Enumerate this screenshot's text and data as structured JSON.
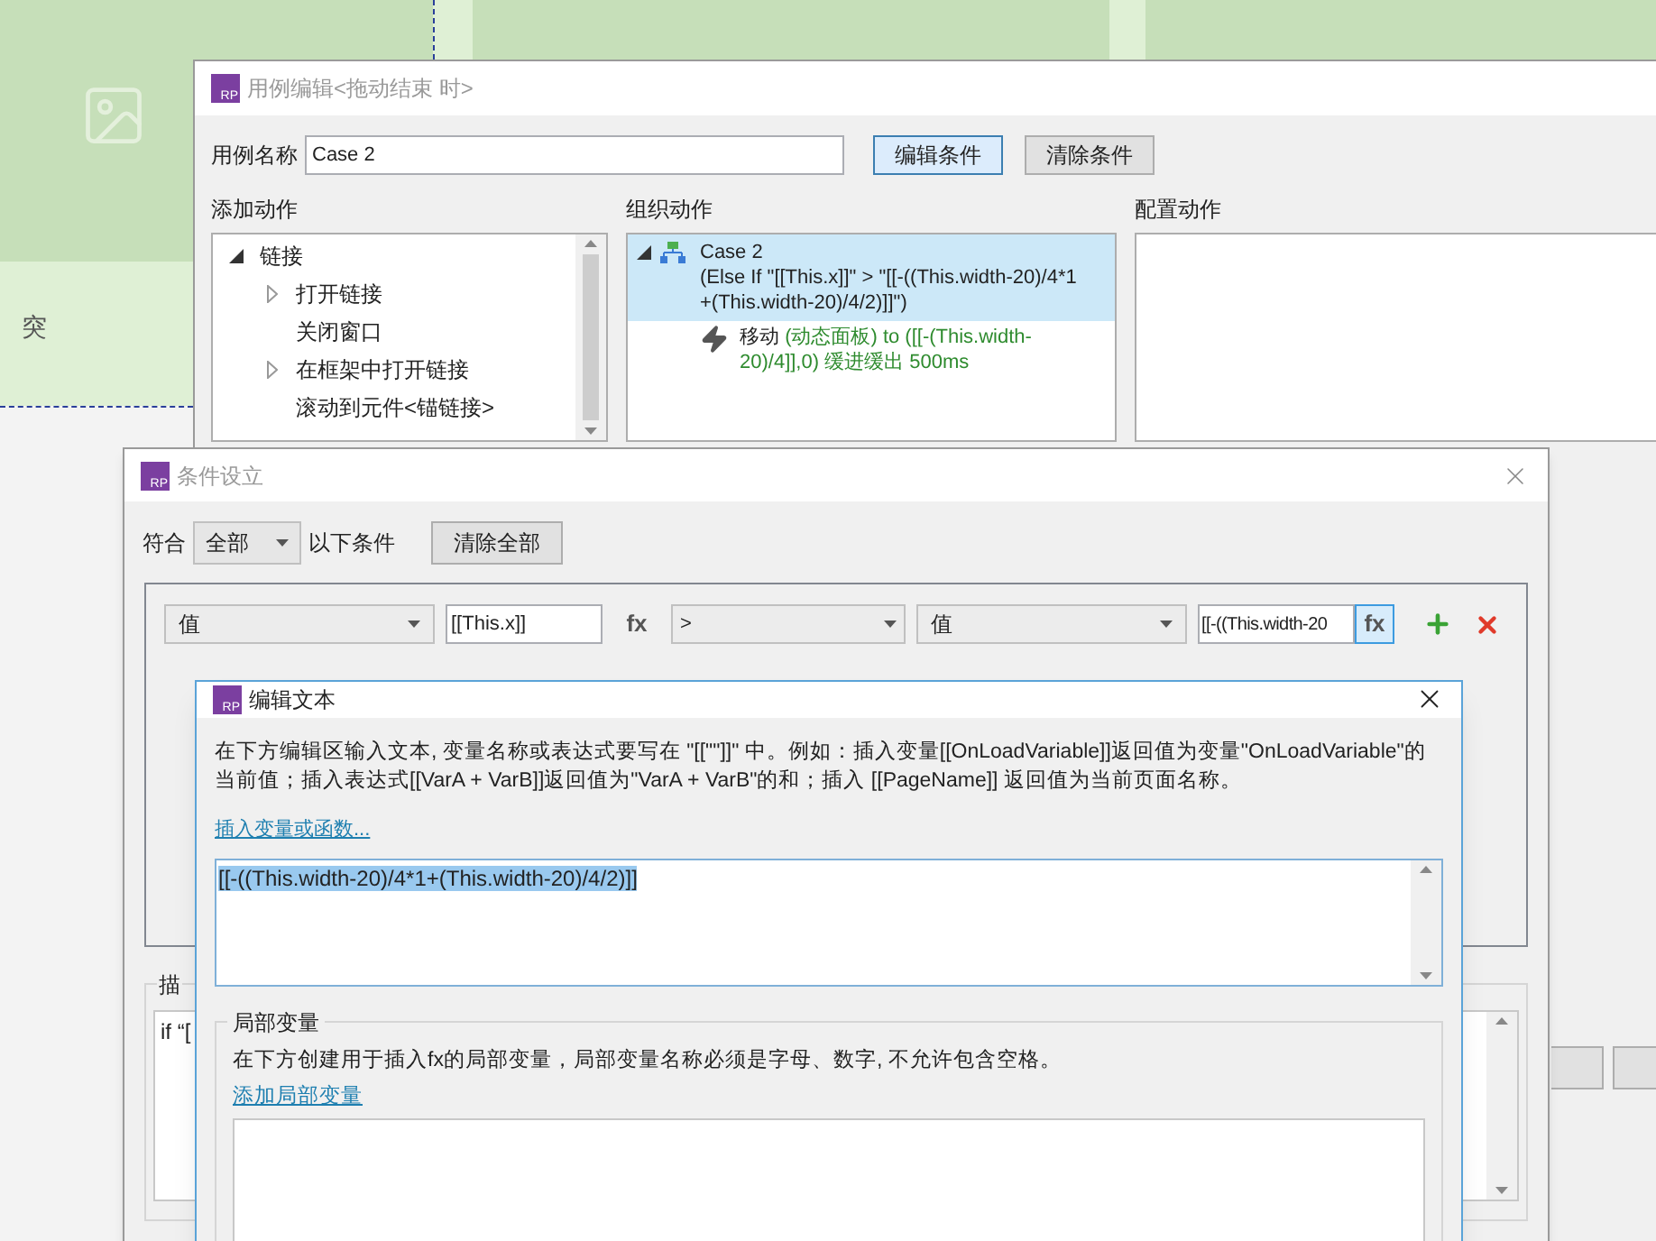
{
  "canvas": {
    "label": "突"
  },
  "case_editor": {
    "logo": "RP",
    "title": "用例编辑<拖动结束 时>",
    "name_label": "用例名称",
    "name_value": "Case 2",
    "buttons": [
      {
        "label": "编辑条件",
        "selected": true
      },
      {
        "label": "清除条件",
        "selected": false
      }
    ],
    "add_actions": {
      "heading": "添加动作",
      "tree": [
        {
          "label": "链接",
          "kind": "folder",
          "expanded": true,
          "children": [
            {
              "label": "打开链接",
              "kind": "folder",
              "expanded": false
            },
            {
              "label": "关闭窗口",
              "kind": "action"
            },
            {
              "label": "在框架中打开链接",
              "kind": "folder",
              "expanded": false
            },
            {
              "label": "滚动到元件<锚链接>",
              "kind": "action"
            }
          ]
        }
      ]
    },
    "organize": {
      "heading": "组织动作",
      "cases": [
        {
          "name": "Case 2",
          "condition": "(Else If \"[[This.x]]\" > \"[[-((This.width-20)/4*1 +(This.width-20)/4/2)]]\")",
          "selected": true,
          "expanded": true,
          "actions": [
            {
              "verb": "移动",
              "detail": "(动态面板) to ([[-(This.width-20)/4]],0) 缓进缓出 500ms"
            }
          ]
        }
      ]
    },
    "configure": {
      "heading": "配置动作"
    }
  },
  "condition_dialog": {
    "logo": "RP",
    "title": "条件设立",
    "match_label": "符合",
    "match_value": "全部",
    "match_suffix": "以下条件",
    "clear_button": "清除全部",
    "rows": [
      {
        "left_type": "值",
        "left_value": "[[This.x]]",
        "left_fx": "fx",
        "operator": ">",
        "right_type": "值",
        "right_value": "[[-((This.width-20",
        "right_fx": "fx",
        "right_fx_selected": true
      }
    ],
    "description": {
      "legend": "描",
      "text": "if “["
    }
  },
  "edit_text_dialog": {
    "logo": "RP",
    "title": "编辑文本",
    "instructions": "在下方编辑区输入文本, 变量名称或表达式要写在 \"[[\"\"]]\" 中。例如：插入变量[[OnLoadVariable]]返回值为变量\"OnLoadVariable\"的当前值；插入表达式[[VarA + VarB]]返回值为\"VarA + VarB\"的和；插入 [[PageName]] 返回值为当前页面名称。",
    "insert_link": "插入变量或函数...",
    "text_value": "[[-((This.width-20)/4*1+(This.width-20)/4/2)]]",
    "text_selected": true,
    "local_vars": {
      "legend": "局部变量",
      "hint": "在下方创建用于插入fx的局部变量，局部变量名称必须是字母、数字, 不允许包含空格。",
      "add_link": "添加局部变量"
    }
  }
}
